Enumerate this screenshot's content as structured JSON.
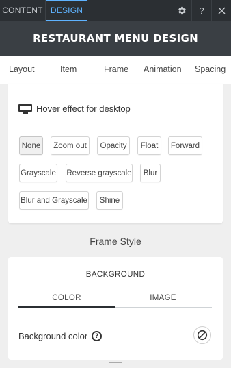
{
  "topbar": {
    "tabs": [
      {
        "label": "CONTENT",
        "active": false
      },
      {
        "label": "DESIGN",
        "active": true
      }
    ],
    "icons": [
      "gear-icon",
      "help-icon",
      "close-icon"
    ],
    "help_glyph": "?",
    "accent_color": "#5fb3ff"
  },
  "title": "RESTAURANT MENU DESIGN",
  "subtabs": [
    {
      "label": "Layout",
      "active": false
    },
    {
      "label": "Item",
      "active": true
    },
    {
      "label": "Frame",
      "active": false
    },
    {
      "label": "Animation",
      "active": false
    },
    {
      "label": "Spacing",
      "active": false
    }
  ],
  "item_panel": {
    "hover_label": "Hover effect for desktop",
    "hover_icon": "monitor-icon",
    "selected_effect": "None",
    "effects": [
      "None",
      "Zoom out",
      "Opacity",
      "Float",
      "Forward",
      "Grayscale",
      "Reverse grayscale",
      "Blur",
      "Blur and Grayscale",
      "Shine"
    ]
  },
  "frame_style": {
    "heading": "Frame Style",
    "background": {
      "title": "BACKGROUND",
      "tabs": [
        {
          "label": "COLOR",
          "active": true
        },
        {
          "label": "IMAGE",
          "active": false
        }
      ],
      "color_label": "Background color",
      "help_glyph": "?",
      "color_value_icon": "no-color-icon",
      "active_line_color": "#2b2f33",
      "inactive_line_color": "#cfd3d6"
    }
  }
}
